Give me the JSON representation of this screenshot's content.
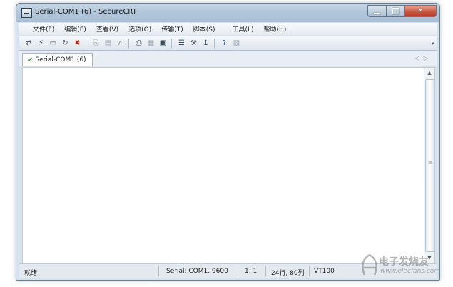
{
  "window": {
    "title": "Serial-COM1 (6) - SecureCRT"
  },
  "menu": [
    "文件(F)",
    "编辑(E)",
    "查看(V)",
    "选项(O)",
    "传输(T)",
    "脚本(S)",
    "工具(L)",
    "帮助(H)"
  ],
  "toolbar": {
    "icons": [
      "connect-icon",
      "quick-connect-icon",
      "connect-tab-icon",
      "reconnect-icon",
      "disconnect-icon",
      "copy-icon",
      "paste-icon",
      "find-icon",
      "print-icon",
      "print-selection-icon",
      "printer-setup-icon",
      "session-options-icon",
      "keymap-icon",
      "sftp-icon",
      "help-icon",
      "about-icon"
    ]
  },
  "tab": {
    "label": "Serial-COM1 (6)",
    "status_icon": "check-icon"
  },
  "status": {
    "ready": "就绪",
    "connection": "Serial: COM1, 9600",
    "cursor": "1,  1",
    "size": "24行, 80列",
    "terminal": "VT100"
  },
  "watermark": {
    "cn": "电子发烧友",
    "en": "www.elecfans.com"
  },
  "colors": {
    "accent": "#3a9a2e",
    "close_button": "#c7523a"
  }
}
